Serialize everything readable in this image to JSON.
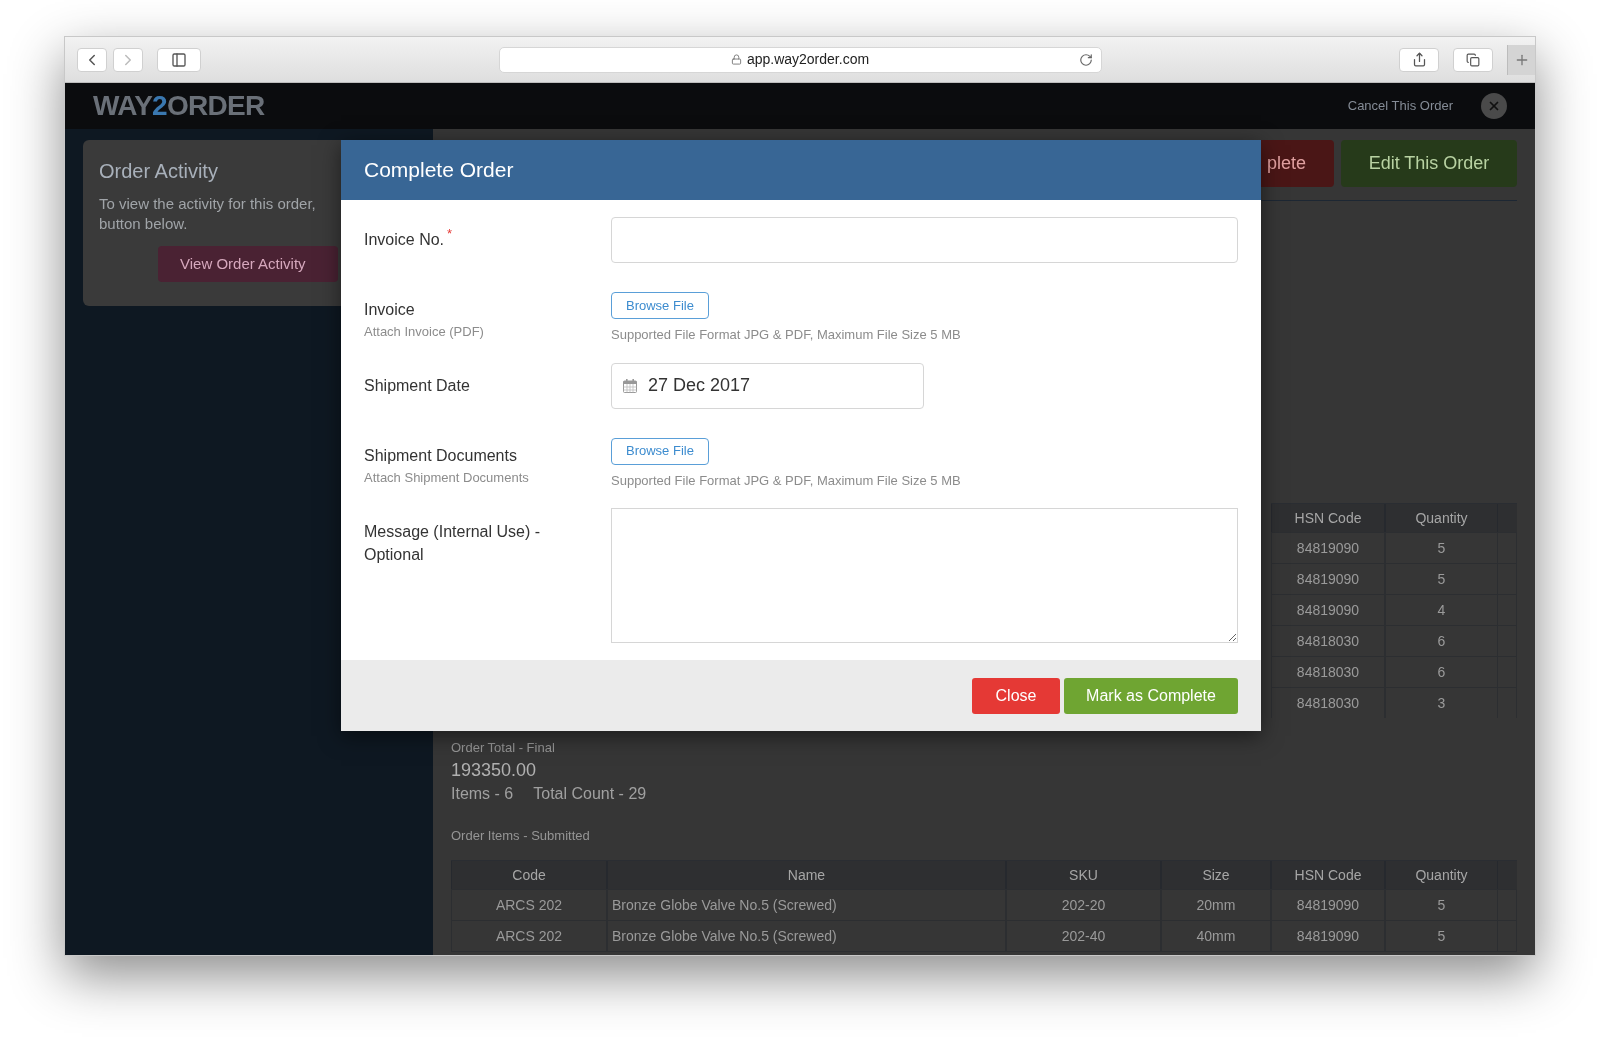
{
  "browser": {
    "url": "app.way2order.com"
  },
  "header": {
    "logo": {
      "before": "WAY",
      "accent": "2",
      "after": "ORDER"
    },
    "cancel_link": "Cancel This Order"
  },
  "sidebar": {
    "card": {
      "title": "Order Activity",
      "text_lines": [
        "To view the activity for this order,",
        "button below."
      ],
      "button": "View Order Activity"
    }
  },
  "actions": [
    {
      "kind": "danger",
      "label": "plete"
    },
    {
      "kind": "success",
      "label": "Edit This Order"
    }
  ],
  "final_items_table": {
    "columns": [
      "HSN Code",
      "Quantity"
    ],
    "rows": [
      [
        "84819090",
        "5"
      ],
      [
        "84819090",
        "5"
      ],
      [
        "84819090",
        "4"
      ],
      [
        "84818030",
        "6"
      ],
      [
        "84818030",
        "6"
      ],
      [
        "84818030",
        "3"
      ]
    ]
  },
  "order_total": {
    "label": "Order Total - Final",
    "value": "193350.00",
    "items": "Items - 6",
    "total_count": "Total Count - 29"
  },
  "submitted_items": {
    "heading": "Order Items - Submitted",
    "columns": [
      "Code",
      "Name",
      "SKU",
      "Size",
      "HSN Code",
      "Quantity"
    ],
    "rows": [
      [
        "ARCS 202",
        "Bronze Globe Valve No.5 (Screwed)",
        "202-20",
        "20mm",
        "84819090",
        "5"
      ],
      [
        "ARCS 202",
        "Bronze Globe Valve No.5 (Screwed)",
        "202-40",
        "40mm",
        "84819090",
        "5"
      ]
    ]
  },
  "modal": {
    "title": "Complete Order",
    "rows": [
      {
        "kind": "text",
        "label": "Invoice No.",
        "required_mark": "*"
      },
      {
        "kind": "file",
        "label": "Invoice",
        "sublabel": "Attach Invoice (PDF)",
        "button": "Browse File",
        "hint": "Supported File Format JPG & PDF, Maximum File Size 5 MB"
      },
      {
        "kind": "date",
        "label": "Shipment Date",
        "value": "27 Dec 2017"
      },
      {
        "kind": "file",
        "label": "Shipment Documents",
        "sublabel": "Attach Shipment Documents",
        "button": "Browse File",
        "hint": "Supported File Format JPG & PDF, Maximum File Size 5 MB"
      },
      {
        "kind": "textarea",
        "label": "Message (Internal Use) - Optional"
      }
    ],
    "buttons": [
      {
        "kind": "danger",
        "label": "Close"
      },
      {
        "kind": "primary",
        "label": "Mark as Complete"
      }
    ]
  }
}
